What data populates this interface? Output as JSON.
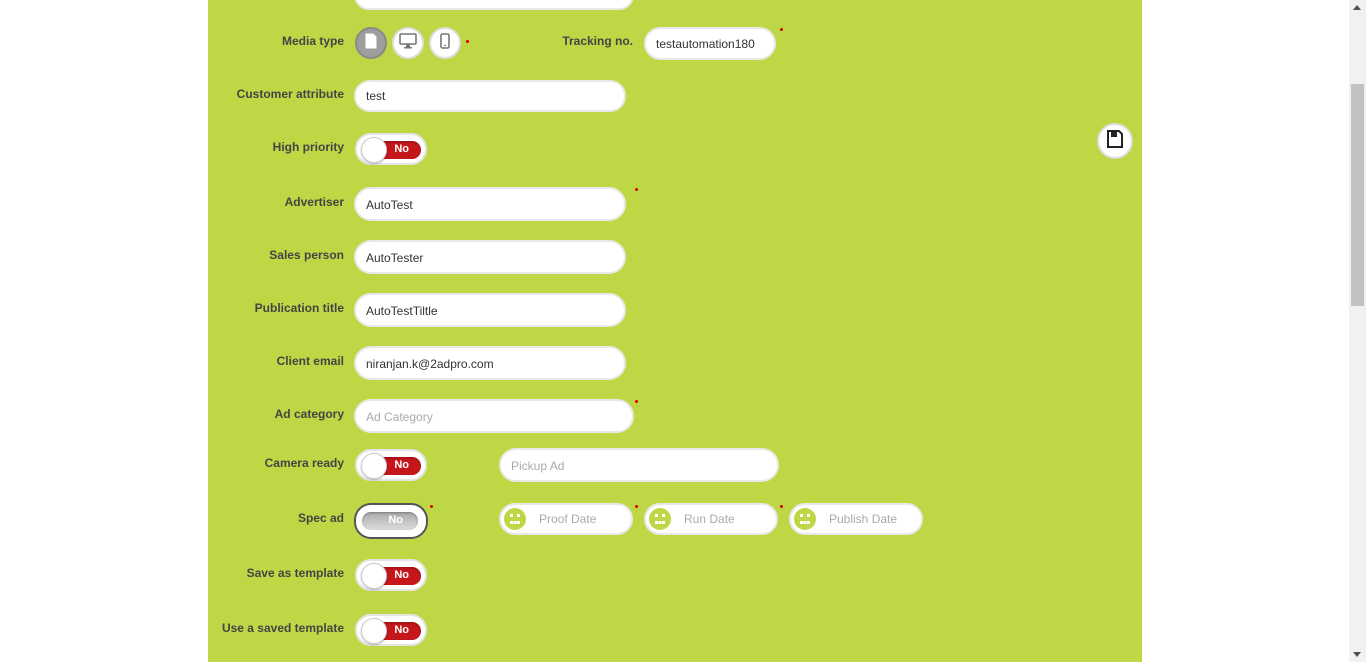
{
  "form": {
    "media_type": {
      "label": "Media type"
    },
    "tracking": {
      "label": "Tracking no.",
      "value": "testautomation180"
    },
    "customer_attribute": {
      "label": "Customer attribute",
      "value": "test"
    },
    "high_priority": {
      "label": "High priority",
      "toggle": "No"
    },
    "advertiser": {
      "label": "Advertiser",
      "value": "AutoTest"
    },
    "sales_person": {
      "label": "Sales person",
      "value": "AutoTester"
    },
    "publication_title": {
      "label": "Publication title",
      "value": "AutoTestTiltle"
    },
    "client_email": {
      "label": "Client email",
      "value": "niranjan.k@2adpro.com"
    },
    "ad_category": {
      "label": "Ad category",
      "placeholder": "Ad Category"
    },
    "camera_ready": {
      "label": "Camera ready",
      "toggle": "No"
    },
    "pickup_ad": {
      "placeholder": "Pickup Ad"
    },
    "spec_ad": {
      "label": "Spec ad",
      "toggle": "No"
    },
    "proof_date": {
      "placeholder": "Proof Date"
    },
    "run_date": {
      "placeholder": "Run Date"
    },
    "publish_date": {
      "placeholder": "Publish Date"
    },
    "save_as_template": {
      "label": "Save as template",
      "toggle": "No"
    },
    "use_saved_template": {
      "label": "Use a saved template",
      "toggle": "No"
    }
  },
  "colors": {
    "panel": "#bed845",
    "toggle_off": "#c5161c",
    "required": "#dd0000"
  },
  "icons": {
    "media_print": "document-icon",
    "media_web": "monitor-icon",
    "media_mobile": "mobile-icon",
    "save": "save-icon",
    "calendar": "calendar-icon"
  }
}
